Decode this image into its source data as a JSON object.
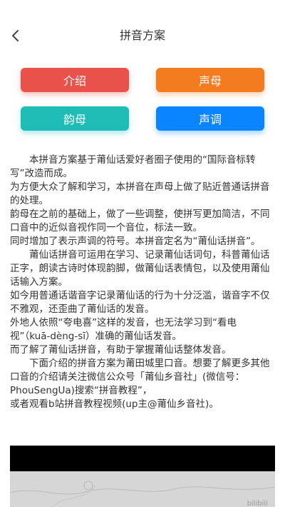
{
  "header": {
    "title": "拼音方案"
  },
  "buttons": {
    "intro": "介绍",
    "initials": "声母",
    "finals": "韵母",
    "tones": "声调"
  },
  "content": {
    "p1": "本拼音方案基于莆仙话爱好者圈子使用的“国际音标转写”改造而成。",
    "p2": "为方便大众了解和学习，本拼音在声母上做了贴近普通话拼音的处理。",
    "p3": "韵母在之前的基础上，做了一些调整，使拼写更加简洁，不同口音中的近似音视作同一个音位，标法一致。",
    "p4": "同时增加了表示声调的符号。本拼音定名为“莆仙话拼音”。",
    "p5": "莆仙话拼音可运用在学习、记录莆仙话词句，科普莆仙话正字，朗读古诗时体现韵脚，做莆仙话表情包，以及使用莆仙话输入方案。",
    "p6": "如今用普通话谐音字记录莆仙话的行为十分泛滥，谐音字不仅不雅观，还歪曲了莆仙话的发音。",
    "p7": "外地人依照“夸电喜”这样的发音，也无法学习到“看电视”（kuā-dèng-sī）准确的莆仙话发音。",
    "p8": "而了解了莆仙话拼音，有助于掌握莆仙话整体发音。",
    "p9": "下面介绍的拼音方案为莆田城里口音。想要了解更多其他口音的介绍请关注微信公众号「莆仙乡音社」(微信号：PhouSengUa)搜索“拼音教程”，",
    "p10": "或者观看b站拼音教程视频(up主@莆仙乡音社)。"
  },
  "video": {
    "watermark": "bilibili"
  }
}
